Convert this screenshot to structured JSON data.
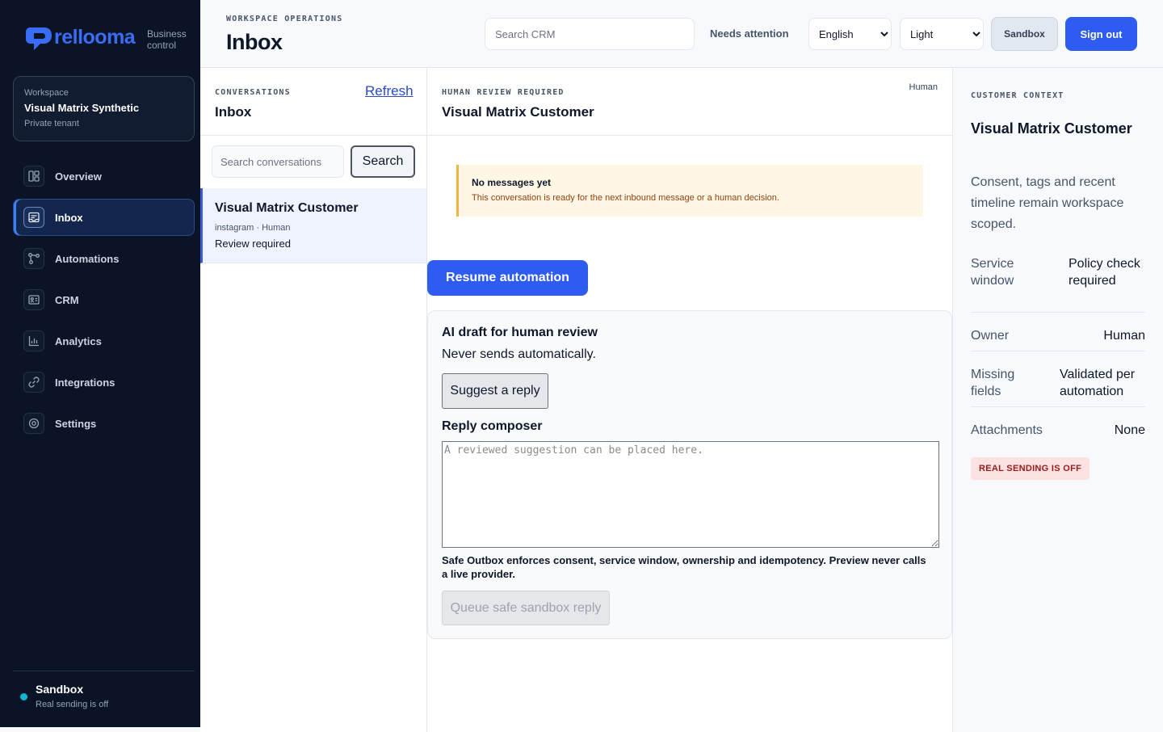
{
  "brand": {
    "name": "rellooma",
    "tagline_line1": "Business",
    "tagline_line2": "control",
    "logo_color": "#3b6cf6"
  },
  "workspace": {
    "label": "Workspace",
    "name": "Visual Matrix Synthetic",
    "tenant": "Private tenant"
  },
  "nav": [
    {
      "label": "Overview",
      "icon": "overview-icon",
      "active": false
    },
    {
      "label": "Inbox",
      "icon": "inbox-icon",
      "active": true
    },
    {
      "label": "Automations",
      "icon": "automations-icon",
      "active": false
    },
    {
      "label": "CRM",
      "icon": "crm-icon",
      "active": false
    },
    {
      "label": "Analytics",
      "icon": "analytics-icon",
      "active": false
    },
    {
      "label": "Integrations",
      "icon": "integrations-icon",
      "active": false
    },
    {
      "label": "Settings",
      "icon": "settings-icon",
      "active": false
    }
  ],
  "sidebar_footer": {
    "mode": "Sandbox",
    "status": "Real sending is off",
    "status_color": "#06b6d4"
  },
  "topbar": {
    "eyebrow": "WORKSPACE OPERATIONS",
    "title": "Inbox",
    "search_placeholder": "Search CRM",
    "needs_attention": "Needs attention",
    "language": "English",
    "language_options": [
      "English"
    ],
    "theme": "Light",
    "theme_options": [
      "Light"
    ],
    "sandbox_label": "Sandbox",
    "signout_label": "Sign out",
    "accent": "#2f5cf0"
  },
  "conversations": {
    "eyebrow": "CONVERSATIONS",
    "title": "Inbox",
    "refresh_label": "Refresh",
    "search_placeholder": "Search conversations",
    "search_button": "Search",
    "items": [
      {
        "name": "Visual Matrix Customer",
        "meta": "instagram · Human",
        "status": "Review required",
        "selected": true
      }
    ]
  },
  "thread": {
    "eyebrow": "HUMAN REVIEW REQUIRED",
    "title": "Visual Matrix Customer",
    "owner": "Human",
    "notice_title": "No messages yet",
    "notice_body": "This conversation is ready for the next inbound message or a human decision.",
    "resume_label": "Resume automation",
    "draft_title": "AI draft for human review",
    "draft_subtitle": "Never sends automatically.",
    "suggest_label": "Suggest a reply",
    "composer_title": "Reply composer",
    "composer_placeholder": "A reviewed suggestion can be placed here.",
    "composer_value": "",
    "safe_note": "Safe Outbox enforces consent, service window, ownership and idempotency. Preview never calls a live provider.",
    "queue_label": "Queue safe sandbox reply"
  },
  "context": {
    "eyebrow": "CUSTOMER CONTEXT",
    "name": "Visual Matrix Customer",
    "description": "Consent, tags and recent timeline remain workspace scoped.",
    "fields": [
      {
        "key": "Service window",
        "value": "Policy check required"
      },
      {
        "key": "Owner",
        "value": "Human"
      },
      {
        "key": "Missing fields",
        "value": "Validated per automation"
      },
      {
        "key": "Attachments",
        "value": "None"
      }
    ],
    "badge": "REAL SENDING IS OFF"
  }
}
